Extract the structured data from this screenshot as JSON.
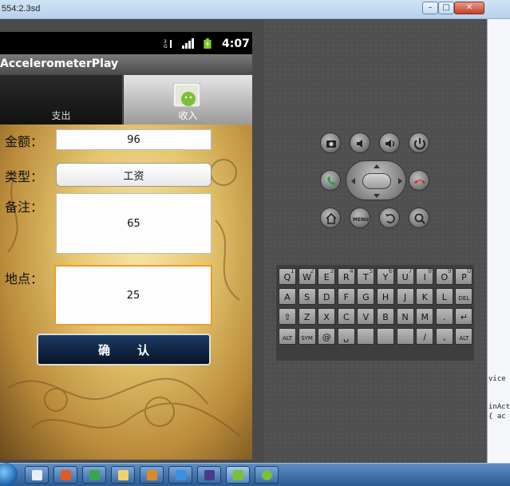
{
  "window": {
    "title": "554:2.3sd",
    "min_label": "–",
    "max_label": "□",
    "close_label": "✕"
  },
  "side_code": {
    "line1": "vice",
    "line2": "inAct",
    "line3": "{ ac"
  },
  "status_bar": {
    "time": "4:07",
    "network_label": "3G"
  },
  "app": {
    "title": "AccelerometerPlay"
  },
  "tabs": [
    {
      "label": "支出",
      "selected": false
    },
    {
      "label": "收入",
      "selected": true,
      "icon": "android-icon"
    }
  ],
  "form": {
    "amount_label": "金额：",
    "amount_value": "96",
    "type_label": "类型：",
    "type_value": "工资",
    "note_label": "备注：",
    "note_value": "65",
    "location_label": "地点：",
    "location_value": "25",
    "confirm_label": "确认"
  },
  "keyboard": {
    "rows": [
      [
        [
          "Q",
          "1"
        ],
        [
          "W",
          "2"
        ],
        [
          "E",
          "3"
        ],
        [
          "R",
          "4"
        ],
        [
          "T",
          "5"
        ],
        [
          "Y",
          "6"
        ],
        [
          "U",
          "7"
        ],
        [
          "I",
          "8"
        ],
        [
          "O",
          "9"
        ],
        [
          "P",
          "0"
        ]
      ],
      [
        [
          "A",
          ""
        ],
        [
          "S",
          ""
        ],
        [
          "D",
          ""
        ],
        [
          "F",
          ""
        ],
        [
          "G",
          ""
        ],
        [
          "H",
          ""
        ],
        [
          "J",
          ""
        ],
        [
          "K",
          ""
        ],
        [
          "L",
          ""
        ],
        [
          "DEL",
          ""
        ]
      ],
      [
        [
          "⇧",
          ""
        ],
        [
          "Z",
          ""
        ],
        [
          "X",
          ""
        ],
        [
          "C",
          ""
        ],
        [
          "V",
          ""
        ],
        [
          "B",
          ""
        ],
        [
          "N",
          ""
        ],
        [
          "M",
          ""
        ],
        [
          ".",
          ""
        ],
        [
          "↵",
          ""
        ]
      ],
      [
        [
          "ALT",
          ""
        ],
        [
          "SYM",
          ""
        ],
        [
          "@",
          ""
        ],
        [
          "␣",
          ""
        ],
        [
          "",
          ""
        ],
        [
          "",
          ""
        ],
        [
          "",
          ""
        ],
        [
          "/",
          ""
        ],
        [
          ",",
          ""
        ],
        [
          "ALT",
          ""
        ]
      ]
    ]
  },
  "colors": {
    "focus_border": "#f09a20",
    "confirm_bg": "#0d1f3c"
  }
}
